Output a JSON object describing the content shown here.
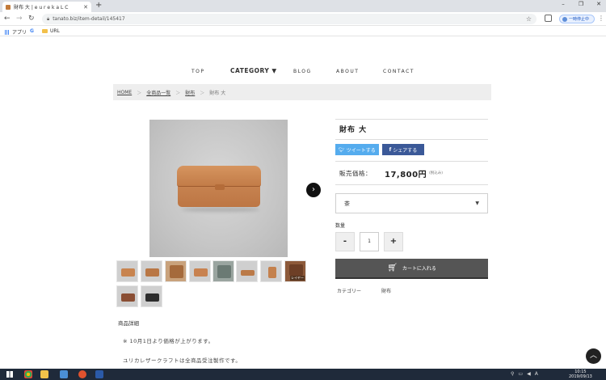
{
  "browser": {
    "tab_title": "財布 大 | e u r e k a L C",
    "tab_close": "✕",
    "new_tab": "+",
    "url": "tanato.biz/item-detail/145417",
    "pause_label": "一時停止中",
    "window_controls": [
      "–",
      "❐",
      "✕"
    ],
    "bookmarks": [
      {
        "label": "アプリ",
        "icon": "apps-grid-icon"
      },
      {
        "label": "G",
        "icon": "google-icon"
      },
      {
        "label": "URL",
        "icon": "folder-icon"
      }
    ]
  },
  "nav": {
    "top": "TOP",
    "category": "CATEGORY ▼",
    "blog": "BLOG",
    "about": "ABOUT",
    "contact": "CONTACT"
  },
  "breadcrumb": {
    "home": "HOME",
    "all": "全商品一覧",
    "cat": "財布",
    "current": "財布 大",
    "sep": "＞"
  },
  "product": {
    "title": "財布 大",
    "tweet": "ツイートする",
    "share": "シェアする",
    "price_label": "販売価格：",
    "price": "17,800円",
    "tax": "(税込み)",
    "option_selected": "茶",
    "qty_label": "数量",
    "qty_minus": "-",
    "qty_value": "1",
    "qty_plus": "+",
    "cart_label": "カートに入れる",
    "meta_label": "カテゴリー",
    "meta_value": "財布",
    "thumb_badge": "レイヤー"
  },
  "details": {
    "heading": "商品詳細",
    "notice": "※ 10月1日より価格が上がります。",
    "desc": "ユリカレザークラフトは全商品受注製作です。"
  },
  "taskbar": {
    "time": "10:15",
    "date": "2019/09/13"
  },
  "colors": {
    "twitter": "#55acee",
    "facebook": "#3b5998",
    "cart": "#555555",
    "leather": "#c8844f"
  }
}
